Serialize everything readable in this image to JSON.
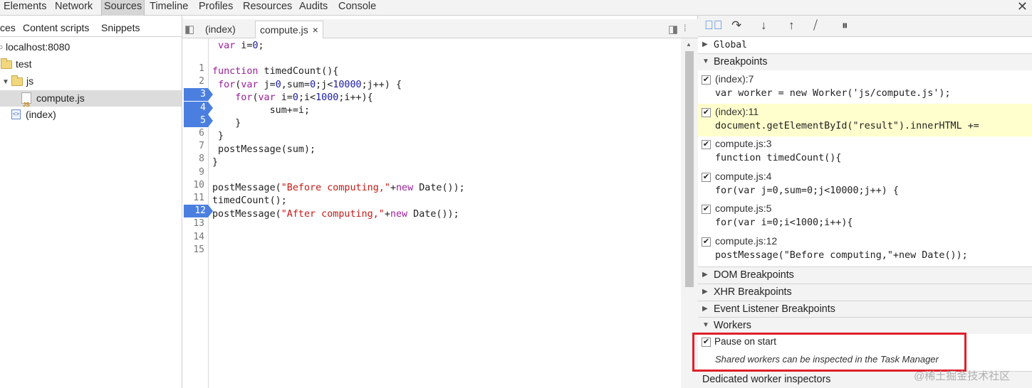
{
  "toolbar": {
    "tabs": [
      "Elements",
      "Network",
      "Sources",
      "Timeline",
      "Profiles",
      "Resources",
      "Audits",
      "Console"
    ],
    "active_tab": "Sources"
  },
  "navigator": {
    "tabs": [
      "ces",
      "Content scripts",
      "Snippets"
    ],
    "tree": {
      "host": "localhost:8080",
      "folder_test": "test",
      "folder_js": "js",
      "file_compute": "compute.js",
      "file_index": "(index)"
    }
  },
  "editor": {
    "tabs": [
      {
        "label": "(index)"
      },
      {
        "label": "compute.js"
      }
    ],
    "close_glyph": "×",
    "breakpoint_lines": [
      3,
      4,
      5,
      12
    ],
    "lines": [
      " var i=0;",
      "",
      "function timedCount(){",
      " for(var j=0,sum=0;j<10000;j++) {",
      "    for(var i=0;i<1000;i++){",
      "          sum+=i;",
      "    }",
      " }",
      " postMessage(sum);",
      "}",
      "",
      "postMessage(\"Before computing,\"+new Date());",
      "timedCount();",
      "postMessage(\"After computing,\"+new Date());",
      ""
    ]
  },
  "sidebar": {
    "global_label": "Global",
    "breakpoints_label": "Breakpoints",
    "breakpoints": [
      {
        "title": "(index):7",
        "code": "var worker = new Worker('js/compute.js');",
        "checked": true
      },
      {
        "title": "(index):11",
        "code": "document.getElementById(\"result\").innerHTML +=",
        "checked": true
      },
      {
        "title": "compute.js:3",
        "code": "function timedCount(){",
        "checked": true
      },
      {
        "title": "compute.js:4",
        "code": "for(var j=0,sum=0;j<10000;j++) {",
        "checked": true
      },
      {
        "title": "compute.js:5",
        "code": "for(var i=0;i<1000;i++){",
        "checked": true
      },
      {
        "title": "compute.js:12",
        "code": "postMessage(\"Before computing,\"+new Date());",
        "checked": true
      }
    ],
    "dom_breakpoints_label": "DOM Breakpoints",
    "xhr_breakpoints_label": "XHR Breakpoints",
    "event_listener_breakpoints_label": "Event Listener Breakpoints",
    "workers_label": "Workers",
    "pause_on_start_label": "Pause on start",
    "shared_workers_note": "Shared workers can be inspected in the Task Manager",
    "dedicated_label": "Dedicated worker inspectors"
  },
  "watermark": "@稀土掘金技术社区",
  "colors": {
    "breakpoint_blue": "#4a7fe0",
    "highlight_yellow": "#ffffcd",
    "annotation_red": "#e0202a"
  }
}
